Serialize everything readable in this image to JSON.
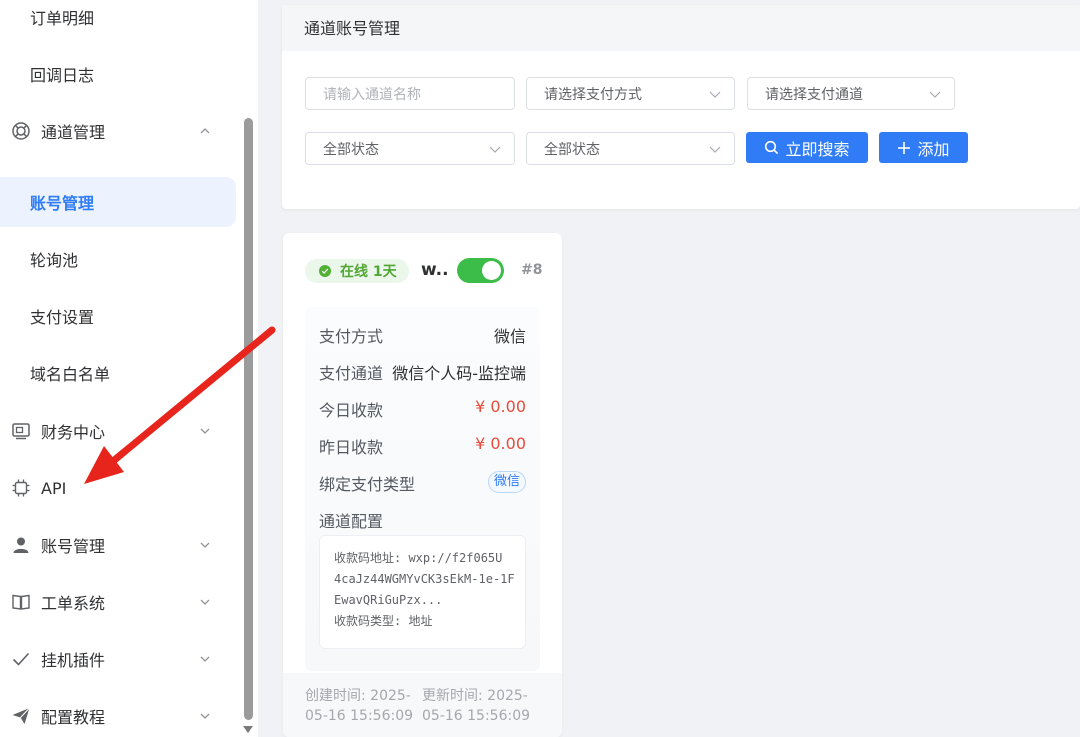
{
  "sidebar": {
    "items": [
      {
        "label": "订单明细",
        "kind": "sub"
      },
      {
        "label": "回调日志",
        "kind": "sub"
      },
      {
        "label": "通道管理",
        "kind": "top",
        "icon": "ring-icon",
        "chevron": "up"
      },
      {
        "label": "账号管理",
        "kind": "sub",
        "active": true
      },
      {
        "label": "轮询池",
        "kind": "sub"
      },
      {
        "label": "支付设置",
        "kind": "sub"
      },
      {
        "label": "域名白名单",
        "kind": "sub"
      },
      {
        "label": "财务中心",
        "kind": "top",
        "icon": "finance-icon",
        "chevron": "down"
      },
      {
        "label": "API",
        "kind": "top",
        "icon": "chip-icon"
      },
      {
        "label": "账号管理",
        "kind": "top",
        "icon": "user-icon",
        "chevron": "down"
      },
      {
        "label": "工单系统",
        "kind": "top",
        "icon": "book-icon",
        "chevron": "down"
      },
      {
        "label": "挂机插件",
        "kind": "top",
        "icon": "check-icon",
        "chevron": "down"
      },
      {
        "label": "配置教程",
        "kind": "top",
        "icon": "send-icon",
        "chevron": "down"
      }
    ]
  },
  "filters": {
    "title": "通道账号管理",
    "name_placeholder": "请输入通道名称",
    "pay_method": "请选择支付方式",
    "pay_channel": "请选择支付通道",
    "status1": "全部状态",
    "status2": "全部状态",
    "search_label": "立即搜索",
    "add_label": "添加"
  },
  "card": {
    "status": "在线 1天",
    "name": "w..",
    "enabled": true,
    "id": "#8",
    "pay_method_label": "支付方式",
    "pay_method_value": "微信",
    "pay_channel_label": "支付通道",
    "pay_channel_value": "微信个人码-监控端",
    "today_label": "今日收款",
    "today_value": "¥ 0.00",
    "yesterday_label": "昨日收款",
    "yesterday_value": "¥ 0.00",
    "bind_type_label": "绑定支付类型",
    "bind_type_value": "微信",
    "config_label": "通道配置",
    "config_lines": [
      "收款码地址: wxp://f2f065U",
      "4caJz44WGMYvCK3sEkM-1e-1F",
      "EwavQRiGuPzx...",
      "收款码类型: 地址"
    ],
    "created_line1": "创建时间: 2025-",
    "created_line2": "05-16 15:56:09",
    "updated_line1": "更新时间: 2025-",
    "updated_line2": "05-16 15:56:09"
  },
  "colors": {
    "accent": "#2f7cf6",
    "online": "#52a635",
    "toggle_on": "#3cbc48",
    "money": "#e64c3c",
    "annotation": "#e8251c"
  }
}
